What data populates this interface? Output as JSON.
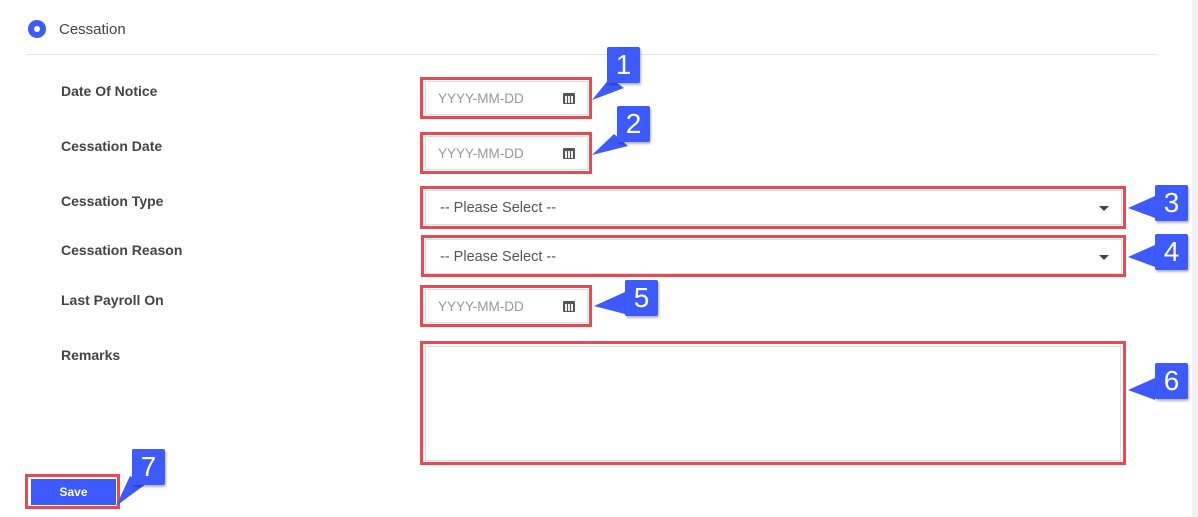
{
  "section": {
    "title": "Cessation"
  },
  "fields": {
    "date_of_notice": {
      "label": "Date Of Notice",
      "placeholder": "YYYY-MM-DD"
    },
    "cessation_date": {
      "label": "Cessation Date",
      "placeholder": "YYYY-MM-DD"
    },
    "cessation_type": {
      "label": "Cessation Type",
      "value": "-- Please Select --"
    },
    "cessation_reason": {
      "label": "Cessation Reason",
      "value": "-- Please Select --"
    },
    "last_payroll_on": {
      "label": "Last Payroll On",
      "placeholder": "YYYY-MM-DD"
    },
    "remarks": {
      "label": "Remarks",
      "value": ""
    }
  },
  "actions": {
    "save_label": "Save"
  },
  "annotations": [
    "1",
    "2",
    "3",
    "4",
    "5",
    "6",
    "7"
  ],
  "colors": {
    "accent": "#3d5afe",
    "highlight": "#e84a54"
  },
  "icons": {
    "section": "radio-icon",
    "date": "calendar-icon",
    "select": "caret-down-icon"
  }
}
